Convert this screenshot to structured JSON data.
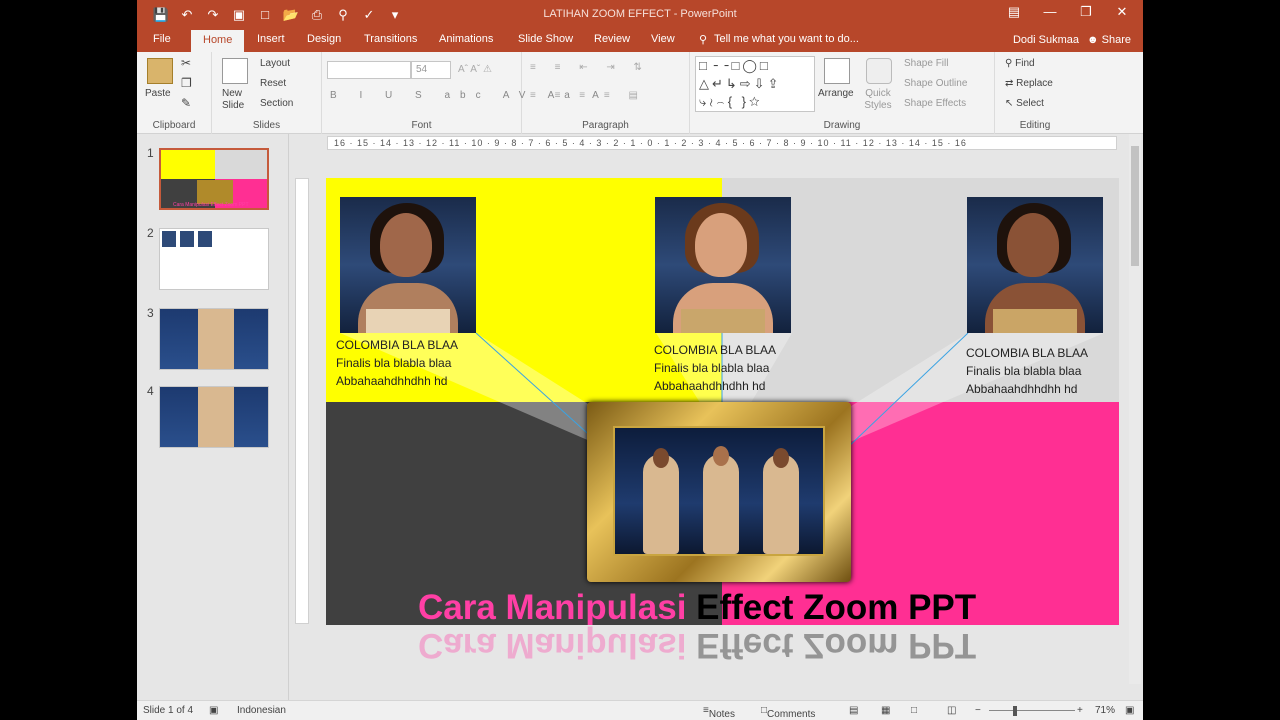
{
  "window": {
    "title": "LATIHAN ZOOM EFFECT - PowerPoint",
    "user": "Dodi Sukmaa",
    "share": "Share"
  },
  "tabs": [
    "File",
    "Home",
    "Insert",
    "Design",
    "Transitions",
    "Animations",
    "Slide Show",
    "Review",
    "View"
  ],
  "tell_me": "Tell me what you want to do...",
  "ribbon": {
    "clipboard": {
      "paste": "Paste",
      "label": "Clipboard"
    },
    "slides": {
      "new_slide": "New Slide",
      "layout": "Layout",
      "reset": "Reset",
      "section": "Section",
      "label": "Slides"
    },
    "font": {
      "size": "54",
      "label": "Font"
    },
    "paragraph": {
      "label": "Paragraph"
    },
    "drawing": {
      "arrange": "Arrange",
      "quick_styles": "Quick Styles",
      "shape_fill": "Shape Fill",
      "shape_outline": "Shape Outline",
      "shape_effects": "Shape Effects",
      "label": "Drawing"
    },
    "editing": {
      "find": "Find",
      "replace": "Replace",
      "select": "Select",
      "label": "Editing"
    }
  },
  "ruler": "16 · 15 · 14 · 13 · 12 · 11 · 10 · 9 · 8 · 7 · 6 · 5 · 4 · 3 · 2 · 1 · 0 · 1 · 2 · 3 · 4 · 5 · 6 · 7 · 8 · 9 · 10 · 11 · 12 · 13 · 14 · 15 · 16",
  "thumbnails": [
    "1",
    "2",
    "3",
    "4"
  ],
  "slide": {
    "captions": [
      [
        "COLOMBIA BLA BLAA",
        "Finalis bla blabla blaa",
        "Abbahaahdhhdhh hd"
      ],
      [
        "COLOMBIA BLA BLAA",
        "Finalis bla blabla blaa",
        "Abbahaahdhhdhh hd"
      ],
      [
        "COLOMBIA BLA BLAA",
        "Finalis bla blabla blaa",
        "Abbahaahdhhdhh hd"
      ]
    ],
    "headline_pink": "Cara Manipulasi ",
    "headline_black": "Effect Zoom PPT"
  },
  "thumb1_text": "Cara Manipulasi Effect Zoom PPT",
  "status": {
    "slide": "Slide 1 of 4",
    "language": "Indonesian",
    "notes": "Notes",
    "comments": "Comments",
    "zoom": "71%"
  }
}
